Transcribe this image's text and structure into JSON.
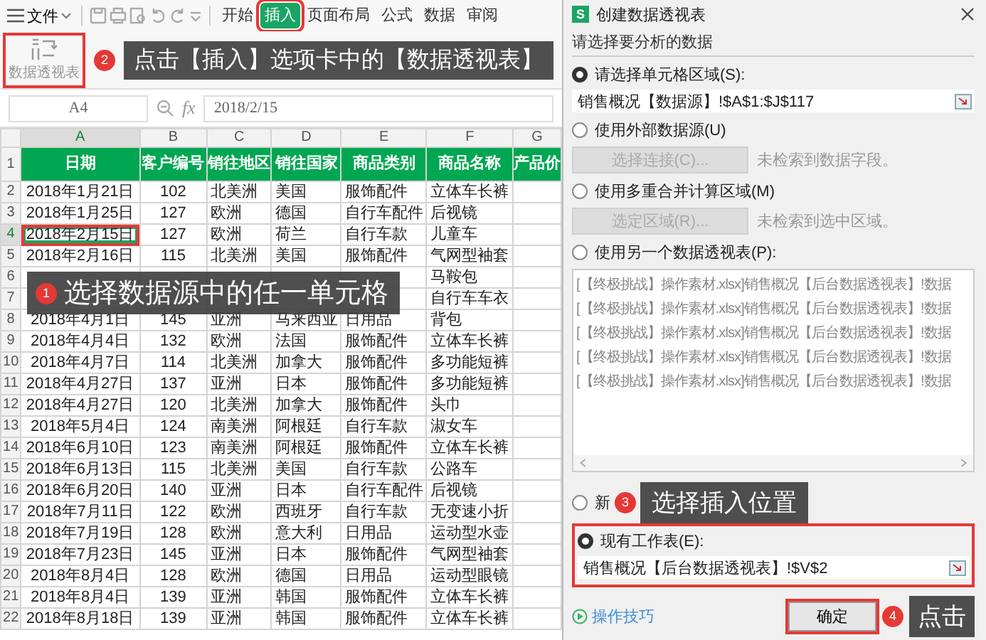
{
  "toolbar": {
    "menu": "文件",
    "tabs": [
      {
        "label": "开始",
        "selected": false
      },
      {
        "label": "插入",
        "selected": true
      },
      {
        "label": "页面布局",
        "selected": false
      },
      {
        "label": "公式",
        "selected": false
      },
      {
        "label": "数据",
        "selected": false
      },
      {
        "label": "审阅",
        "selected": false
      }
    ]
  },
  "ribbon": {
    "pivot_button": "数据透视表",
    "callout": {
      "badge": "2",
      "text": "点击【插入】选项卡中的【数据透视表】"
    }
  },
  "formula_bar": {
    "name_box": "A4",
    "function_label": "fx",
    "formula": "2018/2/15"
  },
  "sheet": {
    "columns": [
      {
        "label": "A",
        "selected": true
      },
      {
        "label": "B",
        "selected": false
      },
      {
        "label": "C",
        "selected": false
      },
      {
        "label": "D",
        "selected": false
      },
      {
        "label": "E",
        "selected": false
      },
      {
        "label": "F",
        "selected": false
      },
      {
        "label": "G",
        "selected": false
      }
    ],
    "header": {
      "number": "1",
      "cells": [
        "日期",
        "客户编号",
        "销往地区",
        "销往国家",
        "商品类别",
        "商品名称",
        "产品价"
      ]
    },
    "rows": [
      {
        "number": "2",
        "selected": false,
        "cells": [
          "2018年1月21日",
          "102",
          "北美洲",
          "美国",
          "服饰配件",
          "立体车长裤"
        ]
      },
      {
        "number": "3",
        "selected": false,
        "cells": [
          "2018年1月25日",
          "127",
          "欧洲",
          "德国",
          "自行车配件",
          "后视镜"
        ]
      },
      {
        "number": "4",
        "selected": true,
        "cells": [
          "2018年2月15日",
          "127",
          "欧洲",
          "荷兰",
          "自行车款",
          "儿童车"
        ]
      },
      {
        "number": "5",
        "selected": false,
        "cells": [
          "2018年2月16日",
          "115",
          "北美洲",
          "美国",
          "服饰配件",
          "气网型袖套"
        ]
      },
      {
        "number": "6",
        "selected": false,
        "cells": [
          null,
          null,
          null,
          null,
          null,
          "马鞍包"
        ]
      },
      {
        "number": "7",
        "selected": false,
        "cells": [
          null,
          null,
          null,
          null,
          null,
          "自行车车衣"
        ]
      },
      {
        "number": "8",
        "selected": false,
        "cells": [
          "2018年4月1日",
          "145",
          "亚洲",
          "马来西亚",
          "日用品",
          "背包"
        ]
      },
      {
        "number": "9",
        "selected": false,
        "cells": [
          "2018年4月4日",
          "132",
          "欧洲",
          "法国",
          "服饰配件",
          "立体车长裤"
        ]
      },
      {
        "number": "10",
        "selected": false,
        "cells": [
          "2018年4月7日",
          "114",
          "北美洲",
          "加拿大",
          "服饰配件",
          "多功能短裤"
        ]
      },
      {
        "number": "11",
        "selected": false,
        "cells": [
          "2018年4月27日",
          "137",
          "亚洲",
          "日本",
          "服饰配件",
          "多功能短裤"
        ]
      },
      {
        "number": "12",
        "selected": false,
        "cells": [
          "2018年4月27日",
          "120",
          "北美洲",
          "加拿大",
          "服饰配件",
          "头巾"
        ]
      },
      {
        "number": "13",
        "selected": false,
        "cells": [
          "2018年5月4日",
          "124",
          "南美洲",
          "阿根廷",
          "自行车款",
          "淑女车"
        ]
      },
      {
        "number": "14",
        "selected": false,
        "cells": [
          "2018年6月10日",
          "123",
          "南美洲",
          "阿根廷",
          "服饰配件",
          "立体车长裤"
        ]
      },
      {
        "number": "15",
        "selected": false,
        "cells": [
          "2018年6月13日",
          "115",
          "北美洲",
          "美国",
          "自行车款",
          "公路车"
        ]
      },
      {
        "number": "16",
        "selected": false,
        "cells": [
          "2018年6月20日",
          "140",
          "亚洲",
          "日本",
          "自行车配件",
          "后视镜"
        ]
      },
      {
        "number": "17",
        "selected": false,
        "cells": [
          "2018年7月11日",
          "122",
          "欧洲",
          "西班牙",
          "自行车款",
          "无变速小折"
        ]
      },
      {
        "number": "18",
        "selected": false,
        "cells": [
          "2018年7月19日",
          "128",
          "欧洲",
          "意大利",
          "日用品",
          "运动型水壶"
        ]
      },
      {
        "number": "19",
        "selected": false,
        "cells": [
          "2018年7月23日",
          "145",
          "亚洲",
          "日本",
          "服饰配件",
          "气网型袖套"
        ]
      },
      {
        "number": "20",
        "selected": false,
        "cells": [
          "2018年8月4日",
          "128",
          "欧洲",
          "德国",
          "日用品",
          "运动型眼镜"
        ]
      },
      {
        "number": "21",
        "selected": false,
        "cells": [
          "2018年8月4日",
          "139",
          "亚洲",
          "韩国",
          "服饰配件",
          "立体车长裤"
        ]
      },
      {
        "number": "22",
        "selected": false,
        "cells": [
          "2018年8月18日",
          "139",
          "亚洲",
          "韩国",
          "服饰配件",
          "立体车长裤"
        ]
      }
    ],
    "callout": {
      "badge": "1",
      "text": "选择数据源中的任一单元格"
    }
  },
  "dialog": {
    "app_badge": "S",
    "title": "创建数据透视表",
    "source_section": "请选择要分析的数据",
    "source_options": [
      {
        "kind": "range",
        "label": "请选择单元格区域(S):",
        "selected": true,
        "value": "销售概况【数据源】!$A$1:$J$117"
      },
      {
        "kind": "button",
        "label": "使用外部数据源(U)",
        "selected": false,
        "button": "选择连接(C)...",
        "hint": "未检索到数据字段。"
      },
      {
        "kind": "button",
        "label": "使用多重合并计算区域(M)",
        "selected": false,
        "button": "选定区域(R)...",
        "hint": "未检索到选中区域。"
      },
      {
        "kind": "list",
        "label": "使用另一个数据透视表(P):",
        "selected": false,
        "items": [
          "[【终极挑战】操作素材.xlsx]销售概况【后台数据透视表】!数据",
          "[【终极挑战】操作素材.xlsx]销售概况【后台数据透视表】!数据",
          "[【终极挑战】操作素材.xlsx]销售概况【后台数据透视表】!数据",
          "[【终极挑战】操作素材.xlsx]销售概况【后台数据透视表】!数据",
          "[【终极挑战】操作素材.xlsx]销售概况【后台数据透视表】!数据"
        ]
      }
    ],
    "placement": {
      "callout": {
        "badge": "3",
        "text": "选择插入位置"
      },
      "new_sheet": {
        "label": "新",
        "selected": false
      },
      "existing_sheet": {
        "label": "现有工作表(E):",
        "selected": true,
        "value": "销售概况【后台数据透视表】!$V$2"
      }
    },
    "footer": {
      "tips_link": "操作技巧",
      "ok_button": "确定",
      "callout": {
        "badge": "4",
        "text": "点击"
      }
    }
  }
}
